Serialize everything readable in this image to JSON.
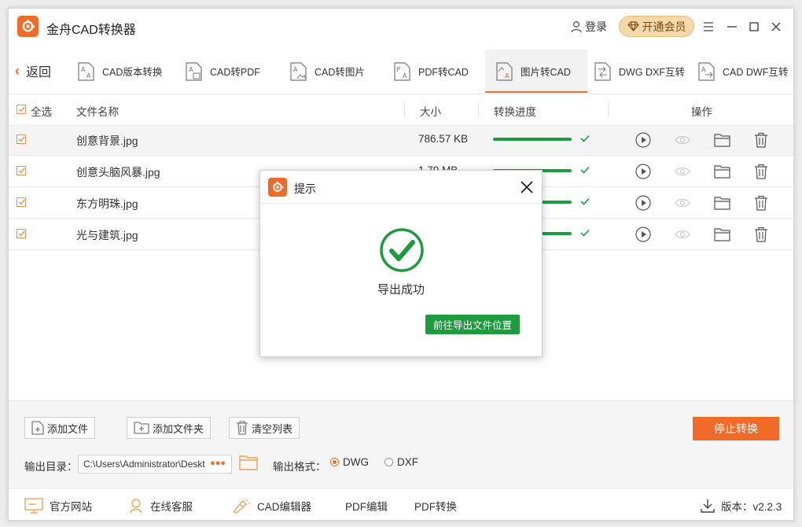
{
  "app": {
    "title": "金舟CAD转换器",
    "login_label": "登录",
    "vip_label": "开通会员",
    "accent_color": "#f06a2a",
    "success_color": "#1e9b3e"
  },
  "toolbar": {
    "back_label": "返回",
    "tools": [
      {
        "label": "CAD版本转换",
        "icon": "cad-version-icon"
      },
      {
        "label": "CAD转PDF",
        "icon": "cad-pdf-icon"
      },
      {
        "label": "CAD转图片",
        "icon": "cad-image-icon"
      },
      {
        "label": "PDF转CAD",
        "icon": "pdf-cad-icon"
      },
      {
        "label": "图片转CAD",
        "icon": "image-cad-icon",
        "active": true
      },
      {
        "label": "DWG DXF互转",
        "icon": "dwg-dxf-icon"
      },
      {
        "label": "CAD DWF互转",
        "icon": "cad-dwf-icon"
      }
    ]
  },
  "table": {
    "headers": {
      "select_all": "全选",
      "name": "文件名称",
      "size": "大小",
      "progress": "转换进度",
      "actions": "操作"
    },
    "rows": [
      {
        "name": "创意背景.jpg",
        "size": "786.57 KB",
        "progress": 1.0,
        "checked": true
      },
      {
        "name": "创意头脑风暴.jpg",
        "size": "1.79 MB",
        "progress": 1.0,
        "checked": true
      },
      {
        "name": "东方明珠.jpg",
        "size": "",
        "progress": 1.0,
        "checked": true
      },
      {
        "name": "光与建筑.jpg",
        "size": "",
        "progress": 1.0,
        "checked": true
      }
    ]
  },
  "bottom": {
    "add_file": "添加文件",
    "add_folder": "添加文件夹",
    "clear_list": "清空列表",
    "stop": "停止转换",
    "output_dir_label": "输出目录：",
    "output_dir_value": "C:\\Users\\Administrator\\Desktop",
    "output_format_label": "输出格式：",
    "formats": [
      {
        "label": "DWG",
        "selected": true
      },
      {
        "label": "DXF",
        "selected": false
      }
    ]
  },
  "footer": {
    "website": "官方网站",
    "support": "在线客服",
    "cad_editor": "CAD编辑器",
    "pdf_editor": "PDF编辑",
    "pdf_convert": "PDF转换",
    "version": "版本：v2.2.3"
  },
  "dialog": {
    "title": "提示",
    "message": "导出成功",
    "button": "前往导出文件位置"
  }
}
